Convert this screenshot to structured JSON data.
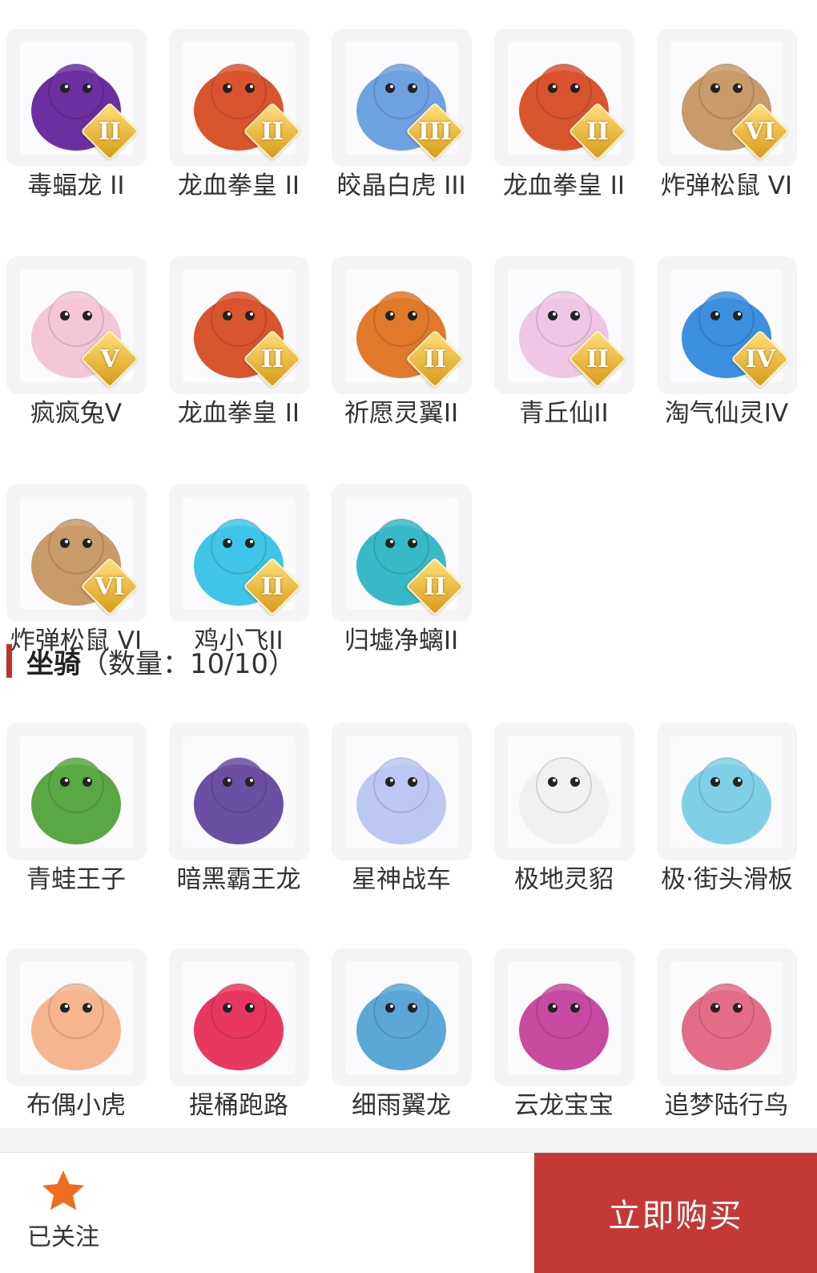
{
  "pets": [
    {
      "name": "毒蝠龙 II",
      "badge": "II",
      "icon": "purple-dragon",
      "color": "#6b2fa0"
    },
    {
      "name": "龙血拳皇 II",
      "badge": "II",
      "icon": "ram-beast",
      "color": "#d9552e"
    },
    {
      "name": "皎晶白虎 III",
      "badge": "III",
      "icon": "white-tiger",
      "color": "#6fa2e0"
    },
    {
      "name": "龙血拳皇 II",
      "badge": "II",
      "icon": "ram-beast",
      "color": "#d9552e"
    },
    {
      "name": "炸弹松鼠 VI",
      "badge": "VI",
      "icon": "squirrel",
      "color": "#c99a6a"
    },
    {
      "name": "疯疯兔V",
      "badge": "V",
      "icon": "pink-rabbit",
      "color": "#f4c6d8"
    },
    {
      "name": "龙血拳皇 II",
      "badge": "II",
      "icon": "ram-beast",
      "color": "#d9552e"
    },
    {
      "name": "祈愿灵翼II",
      "badge": "II",
      "icon": "eagle",
      "color": "#e07a2a"
    },
    {
      "name": "青丘仙II",
      "badge": "II",
      "icon": "fox-fairy",
      "color": "#efc7e5"
    },
    {
      "name": "淘气仙灵IV",
      "badge": "IV",
      "icon": "blue-puppy",
      "color": "#3d8fe0"
    },
    {
      "name": "炸弹松鼠 VI",
      "badge": "VI",
      "icon": "squirrel",
      "color": "#c99a6a"
    },
    {
      "name": "鸡小飞II",
      "badge": "II",
      "icon": "chick-muscle",
      "color": "#3fc5e8"
    },
    {
      "name": "归墟净螭II",
      "badge": "II",
      "icon": "cyan-dragon",
      "color": "#38b9c7"
    }
  ],
  "mounts_section": {
    "title": "坐骑",
    "count_text": "（数量：10/10）"
  },
  "mounts_row1": [
    {
      "name": "青蛙王子",
      "icon": "frog-prince",
      "color": "#5aa843"
    },
    {
      "name": "暗黑霸王龙",
      "icon": "dark-trex",
      "color": "#6b4fa3"
    },
    {
      "name": "星神战车",
      "icon": "star-horse",
      "color": "#bcc8f2"
    },
    {
      "name": "极地灵貂",
      "icon": "polar-mink",
      "color": "#f1f1f1"
    },
    {
      "name": "极·街头滑板",
      "icon": "skateboard",
      "color": "#7fd0e6"
    }
  ],
  "mounts_row2": [
    {
      "name": "布偶小虎",
      "icon": "toy-tiger",
      "color": "#f5b58f"
    },
    {
      "name": "提桶跑路",
      "icon": "buckets",
      "color": "#e8385e"
    },
    {
      "name": "细雨翼龙",
      "icon": "pterosaur",
      "color": "#5ba7d6"
    },
    {
      "name": "云龙宝宝",
      "icon": "cloud-dragon",
      "color": "#c64aa0"
    },
    {
      "name": "追梦陆行鸟",
      "icon": "dream-bird",
      "color": "#e36d86"
    }
  ],
  "bottom": {
    "follow_label": "已关注",
    "buy_label": "立即购买"
  },
  "colors": {
    "accent": "#c33a35",
    "star": "#f26c1d",
    "card_bg": "#f4f4f6"
  }
}
